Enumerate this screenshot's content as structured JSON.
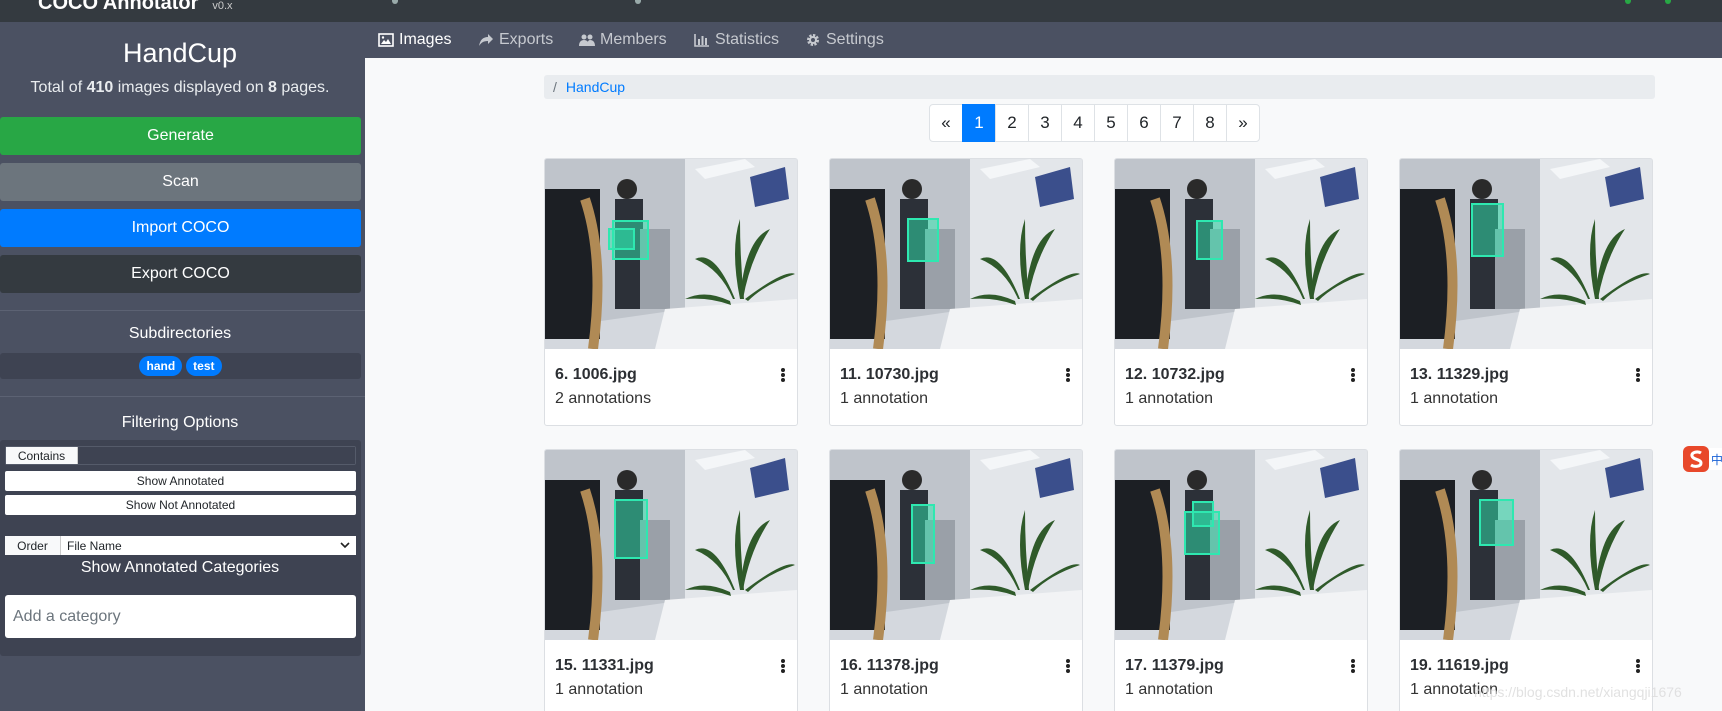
{
  "app": {
    "brand": "COCO Annotator",
    "version": "v0.x"
  },
  "sidebar": {
    "dataset_name": "HandCup",
    "total_prefix": "Total of ",
    "total_images": "410",
    "total_middle": " images displayed on ",
    "total_pages": "8",
    "total_suffix": " pages.",
    "buttons": {
      "generate": "Generate",
      "scan": "Scan",
      "import": "Import COCO",
      "export": "Export COCO"
    },
    "subdirectories_title": "Subdirectories",
    "subdirectories": [
      "hand",
      "test"
    ],
    "filtering_title": "Filtering Options",
    "contains_label": "Contains",
    "contains_value": "",
    "show_annotated": "Show Annotated",
    "show_not_annotated": "Show Not Annotated",
    "order_label": "Order",
    "order_value": "File Name",
    "show_categories_title": "Show Annotated Categories",
    "category_placeholder": "Add a category"
  },
  "tabs": [
    {
      "label": "Images",
      "icon": "image-icon",
      "active": true
    },
    {
      "label": "Exports",
      "icon": "share-icon",
      "active": false
    },
    {
      "label": "Members",
      "icon": "users-icon",
      "active": false
    },
    {
      "label": "Statistics",
      "icon": "bar-chart-icon",
      "active": false
    },
    {
      "label": "Settings",
      "icon": "gear-icon",
      "active": false
    }
  ],
  "breadcrumb": {
    "separator": "/",
    "current": "HandCup"
  },
  "pagination": {
    "prev": "«",
    "next": "»",
    "pages": [
      "1",
      "2",
      "3",
      "4",
      "5",
      "6",
      "7",
      "8"
    ],
    "current": "1"
  },
  "images": [
    {
      "name": "6. 1006.jpg",
      "annotations": "2 annotations"
    },
    {
      "name": "11. 10730.jpg",
      "annotations": "1 annotation"
    },
    {
      "name": "12. 10732.jpg",
      "annotations": "1 annotation"
    },
    {
      "name": "13. 11329.jpg",
      "annotations": "1 annotation"
    },
    {
      "name": "15. 11331.jpg",
      "annotations": "1 annotation"
    },
    {
      "name": "16. 11378.jpg",
      "annotations": "1 annotation"
    },
    {
      "name": "17. 11379.jpg",
      "annotations": "1 annotation"
    },
    {
      "name": "19. 11619.jpg",
      "annotations": "1 annotation"
    }
  ],
  "colors": {
    "annotation": "#2ee8b0",
    "primary": "#007bff",
    "success": "#28a745",
    "secondary": "#6c757d",
    "dark": "#343a40",
    "sidebar": "#4b5162"
  },
  "watermark": "https://blog.csdn.net/xiangqji1676",
  "floating_widget": {
    "icon": "sogou-ime-icon",
    "label": "中"
  }
}
